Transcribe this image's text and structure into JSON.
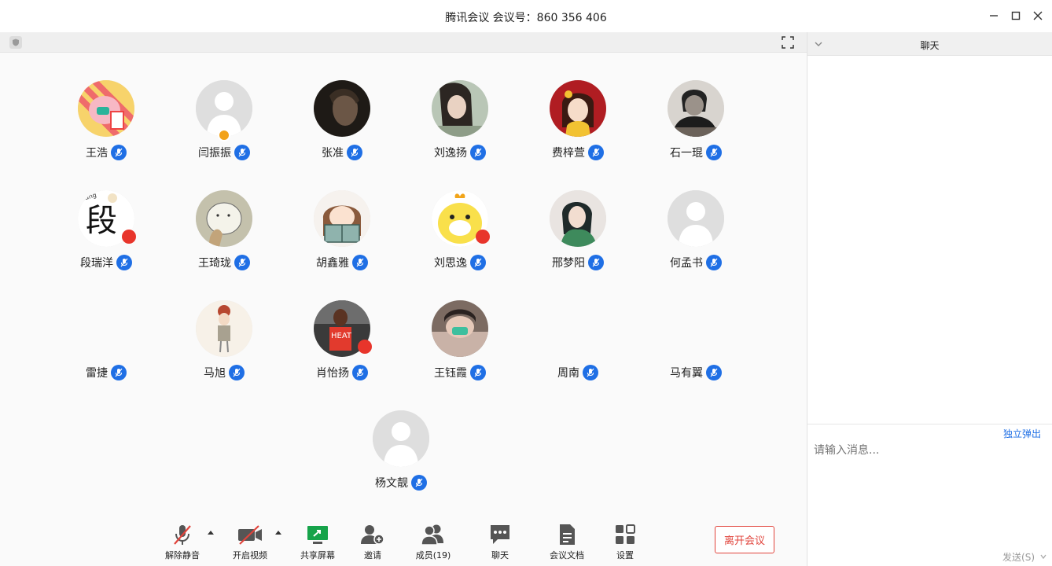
{
  "window": {
    "title": "腾讯会议 会议号：860 356 406"
  },
  "participants": [
    {
      "name": "王浩",
      "avatar": "pig-cartoon"
    },
    {
      "name": "闫振振",
      "avatar": "default-silhouette"
    },
    {
      "name": "张准",
      "avatar": "portrait-dark"
    },
    {
      "name": "刘逸扬",
      "avatar": "portrait-girl"
    },
    {
      "name": "费梓萱",
      "avatar": "cartoon-girl-red"
    },
    {
      "name": "石一琨",
      "avatar": "portrait-bw"
    },
    {
      "name": "段瑞洋",
      "avatar": "text-duan",
      "avatar_text": "段"
    },
    {
      "name": "王琦珑",
      "avatar": "sketch-cat"
    },
    {
      "name": "胡鑫雅",
      "avatar": "anime-girl-book"
    },
    {
      "name": "刘思逸",
      "avatar": "yellow-chick"
    },
    {
      "name": "邢梦阳",
      "avatar": "anime-woman-scarf"
    },
    {
      "name": "何孟书",
      "avatar": "default-silhouette"
    },
    {
      "name": "雷捷",
      "avatar": "none"
    },
    {
      "name": "马旭",
      "avatar": "doll-figure"
    },
    {
      "name": "肖怡扬",
      "avatar": "basketball-player"
    },
    {
      "name": "王钰霞",
      "avatar": "portrait-mask"
    },
    {
      "name": "周南",
      "avatar": "none"
    },
    {
      "name": "马有翼",
      "avatar": "none"
    },
    {
      "name": "杨文靓",
      "avatar": "default-silhouette"
    }
  ],
  "toolbar": {
    "unmute": "解除静音",
    "start_video": "开启视频",
    "share_screen": "共享屏幕",
    "invite": "邀请",
    "members": "成员(19)",
    "chat": "聊天",
    "docs": "会议文档",
    "settings": "设置",
    "leave": "离开会议"
  },
  "chat": {
    "title": "聊天",
    "popout": "独立弹出",
    "placeholder": "请输入消息...",
    "send": "发送(S)"
  },
  "colors": {
    "accent": "#1f6fe5",
    "leave": "#e1443c",
    "share_green": "#16a34a"
  }
}
